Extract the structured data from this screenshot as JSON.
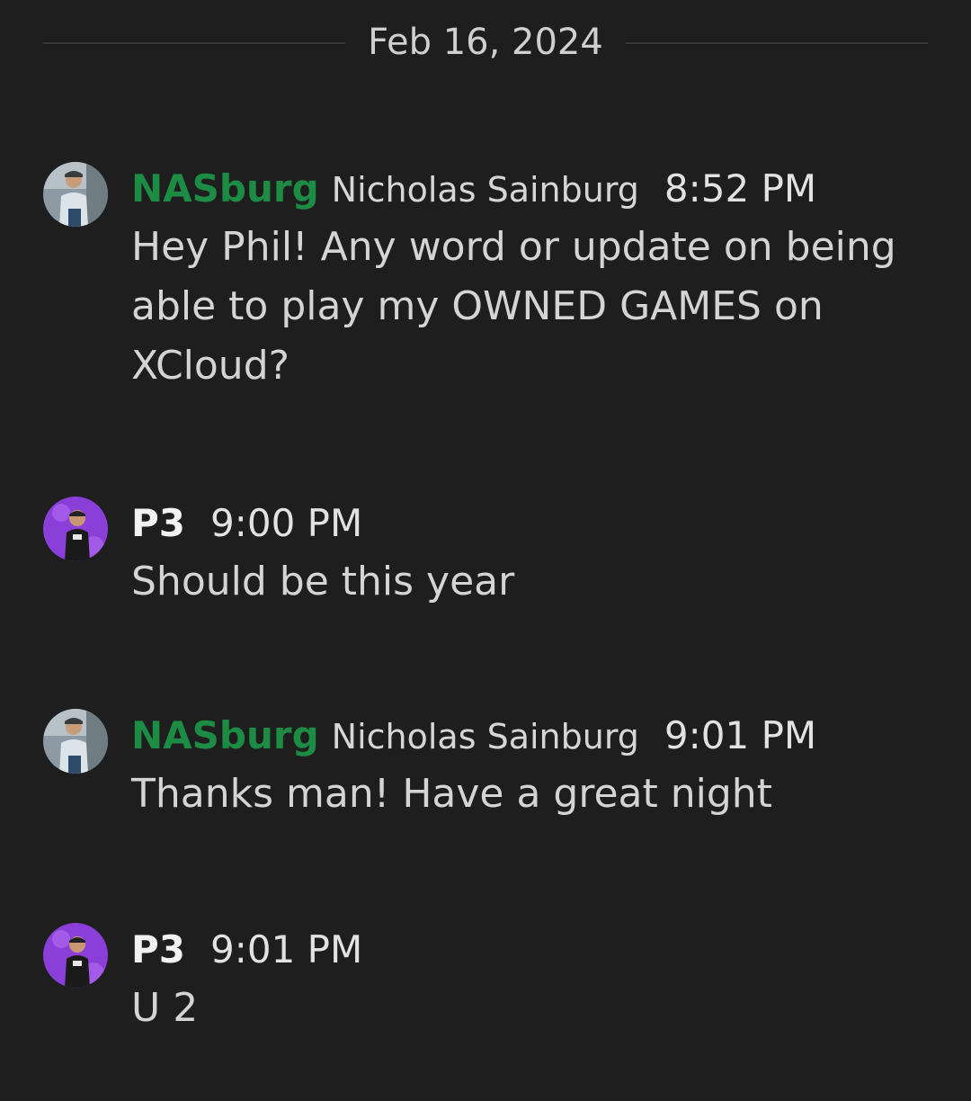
{
  "date_divider": "Feb 16, 2024",
  "messages": [
    {
      "gamertag": "NASburg",
      "real_name": "Nicholas Sainburg",
      "time": "8:52 PM",
      "text": "Hey Phil! Any word or update on being able to play my OWNED GAMES on XCloud?",
      "avatar": "user-photo-avatar"
    },
    {
      "gamertag": "P3",
      "time": "9:00 PM",
      "text": "Should be this year",
      "avatar": "xbox-avatar-purple"
    },
    {
      "gamertag": "NASburg",
      "real_name": "Nicholas Sainburg",
      "time": "9:01 PM",
      "text": "Thanks man! Have a great night",
      "avatar": "user-photo-avatar"
    },
    {
      "gamertag": "P3",
      "time": "9:01 PM",
      "text": "U 2",
      "avatar": "xbox-avatar-purple"
    }
  ],
  "colors": {
    "background": "#1e1e1e",
    "gamertag_green": "#1c8c44",
    "avatar_purple": "#8b3fd9"
  }
}
